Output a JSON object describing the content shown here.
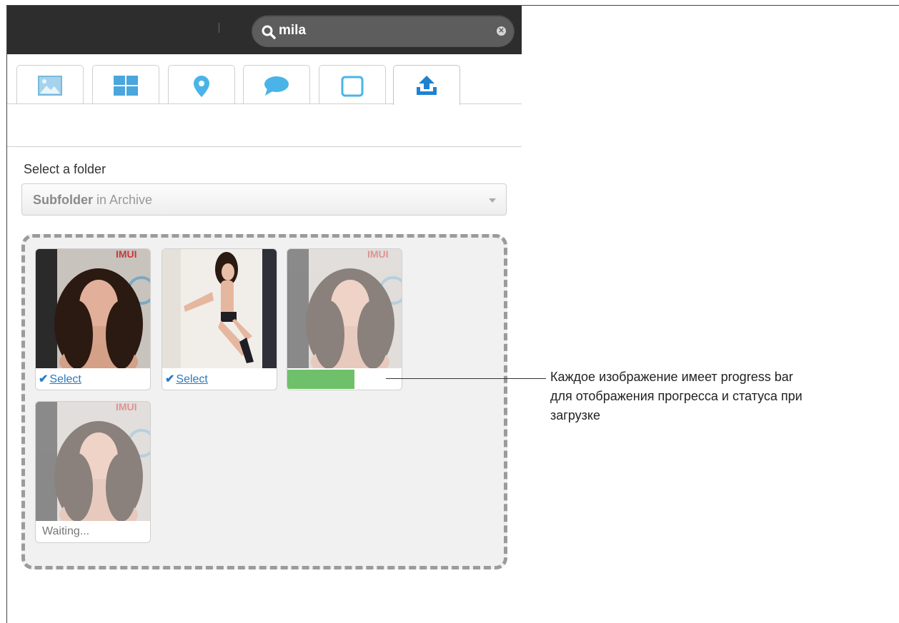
{
  "search": {
    "value": "mila"
  },
  "tabs": [
    {
      "icon": "image-icon"
    },
    {
      "icon": "grid-icon"
    },
    {
      "icon": "map-pin-icon"
    },
    {
      "icon": "speech-bubble-icon"
    },
    {
      "icon": "square-icon"
    },
    {
      "icon": "upload-icon",
      "active": true
    }
  ],
  "folder": {
    "label": "Select a folder",
    "selected_bold": "Subfolder",
    "selected_rest": " in Archive"
  },
  "uploads": [
    {
      "status": "Select",
      "type": "done"
    },
    {
      "status": "Select",
      "type": "done"
    },
    {
      "type": "progress",
      "progress": 0.59
    },
    {
      "status": "Waiting...",
      "type": "waiting"
    }
  ],
  "callout": {
    "line1": "Каждое изображение имеет progress bar",
    "line2": "для отображения прогресса и статуса при",
    "line3": "загрузке"
  },
  "colors": {
    "accent": "#2a7ac0",
    "progress": "#6fc06a",
    "topbar": "#2d2d2d"
  }
}
